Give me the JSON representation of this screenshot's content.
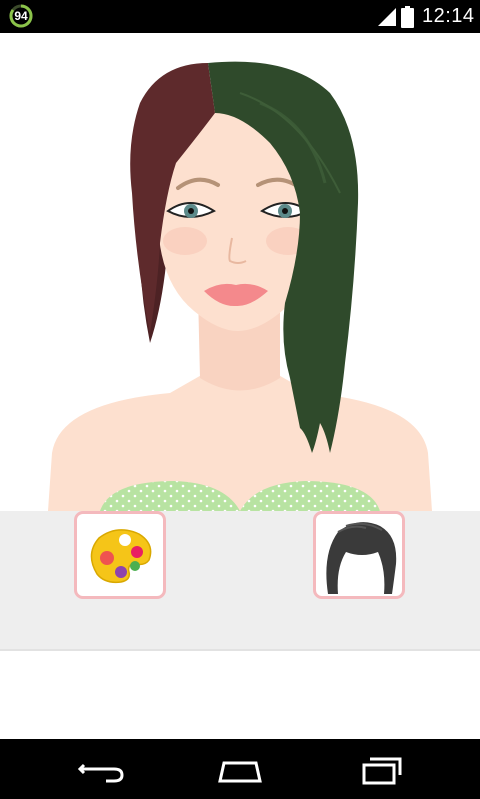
{
  "status_bar": {
    "notification_count": "94",
    "time": "12:14",
    "icons": [
      "notification-badge-icon",
      "signal-icon",
      "battery-icon"
    ]
  },
  "avatar": {
    "hair_colors": {
      "left": "#5e2a2c",
      "right": "#2f4a2b"
    },
    "lip_color": "#f4898c",
    "eye_color": "#5c8a8a",
    "top_color": "#b8e3a2"
  },
  "toolbar": {
    "items": [
      {
        "name": "color-palette",
        "icon": "palette-icon"
      },
      {
        "name": "hairstyle",
        "icon": "hairstyle-icon"
      }
    ],
    "border_color": "#f4b9bd"
  },
  "nav_bar": {
    "icons": [
      "back-icon",
      "home-icon",
      "recents-icon"
    ]
  }
}
